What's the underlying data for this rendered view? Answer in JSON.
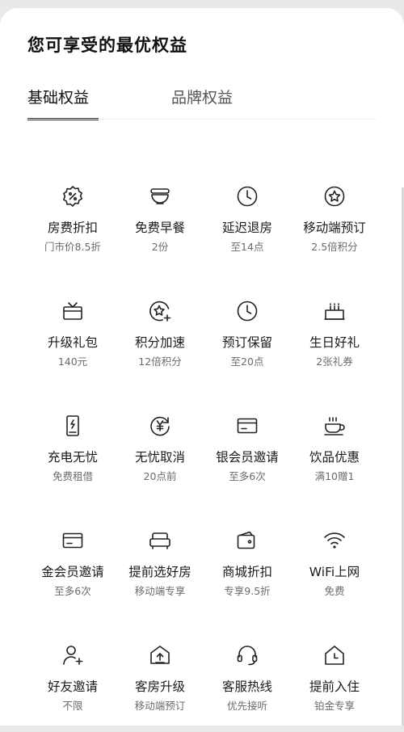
{
  "title": "您可享受的最优权益",
  "tabs": [
    {
      "label": "基础权益",
      "active": true
    },
    {
      "label": "品牌权益",
      "active": false
    }
  ],
  "benefits": [
    {
      "icon": "discount-badge-icon",
      "name": "房费折扣",
      "desc": "门市价8.5折"
    },
    {
      "icon": "breakfast-bowl-icon",
      "name": "免费早餐",
      "desc": "2份"
    },
    {
      "icon": "clock-icon",
      "name": "延迟退房",
      "desc": "至14点"
    },
    {
      "icon": "star-badge-icon",
      "name": "移动端预订",
      "desc": "2.5倍积分"
    },
    {
      "icon": "gift-box-icon",
      "name": "升级礼包",
      "desc": "140元"
    },
    {
      "icon": "star-plus-icon",
      "name": "积分加速",
      "desc": "12倍积分"
    },
    {
      "icon": "clock-icon",
      "name": "预订保留",
      "desc": "至20点"
    },
    {
      "icon": "birthday-cake-icon",
      "name": "生日好礼",
      "desc": "2张礼券"
    },
    {
      "icon": "power-bank-icon",
      "name": "充电无忧",
      "desc": "免费租借"
    },
    {
      "icon": "yen-refresh-icon",
      "name": "无忧取消",
      "desc": "20点前"
    },
    {
      "icon": "member-card-icon",
      "name": "银会员邀请",
      "desc": "至多6次"
    },
    {
      "icon": "coffee-cup-icon",
      "name": "饮品优惠",
      "desc": "满10赠1"
    },
    {
      "icon": "member-card-icon",
      "name": "金会员邀请",
      "desc": "至多6次"
    },
    {
      "icon": "bed-icon",
      "name": "提前选好房",
      "desc": "移动端专享"
    },
    {
      "icon": "wallet-tag-icon",
      "name": "商城折扣",
      "desc": "专享9.5折"
    },
    {
      "icon": "wifi-icon",
      "name": "WiFi上网",
      "desc": "免费"
    },
    {
      "icon": "add-user-icon",
      "name": "好友邀请",
      "desc": "不限"
    },
    {
      "icon": "room-upgrade-icon",
      "name": "客房升级",
      "desc": "移动端预订"
    },
    {
      "icon": "headset-icon",
      "name": "客服热线",
      "desc": "优先接听"
    },
    {
      "icon": "house-clock-icon",
      "name": "提前入住",
      "desc": "铂金专享"
    }
  ]
}
